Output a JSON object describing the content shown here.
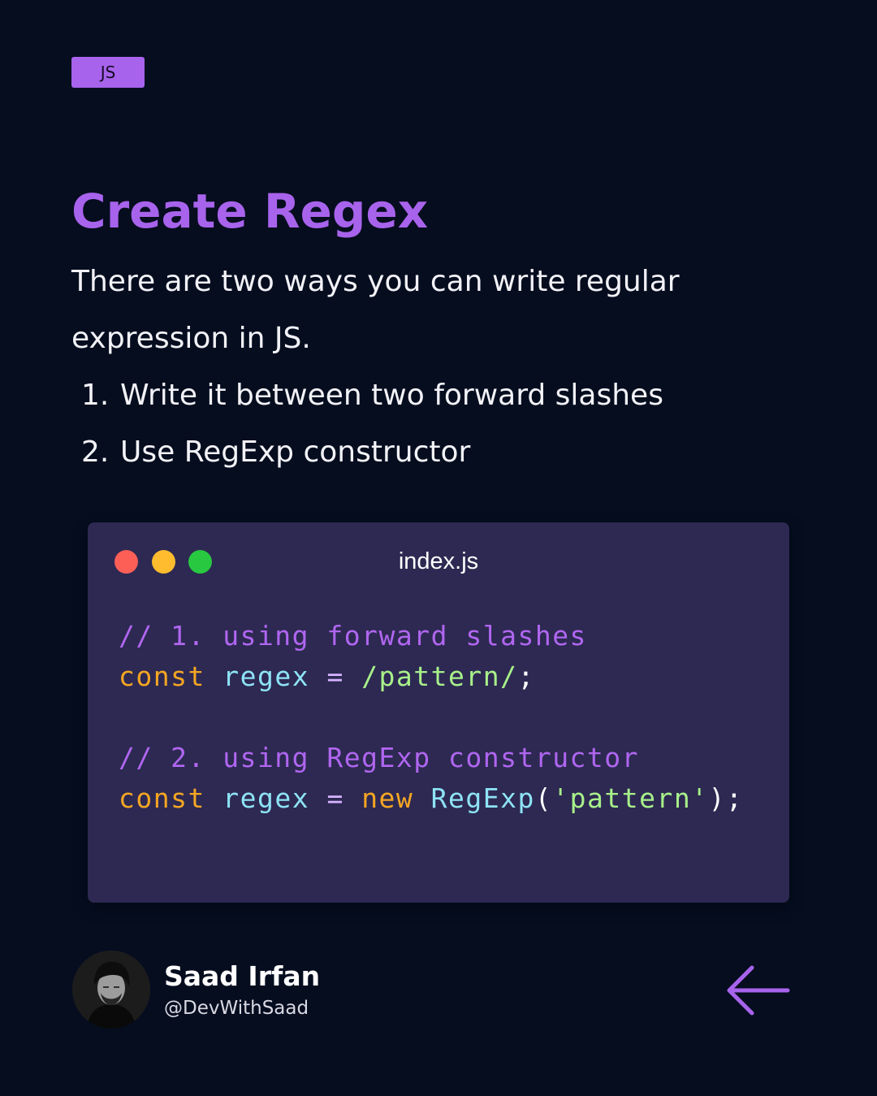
{
  "badge": {
    "label": "JS"
  },
  "title": "Create Regex",
  "intro": "There are two ways you can write regular expression in JS.",
  "steps": [
    {
      "num": "1.",
      "text": "Write it between two forward slashes"
    },
    {
      "num": "2.",
      "text": "Use RegExp constructor"
    }
  ],
  "code_window": {
    "filename": "index.js",
    "lines": [
      [
        {
          "type": "comment",
          "text": "// 1. using forward slashes"
        }
      ],
      [
        {
          "type": "keyword",
          "text": "const "
        },
        {
          "type": "var",
          "text": "regex "
        },
        {
          "type": "op",
          "text": "= "
        },
        {
          "type": "regex",
          "text": "/pattern/"
        },
        {
          "type": "punc",
          "text": ";"
        }
      ],
      [],
      [
        {
          "type": "comment",
          "text": "// 2. using RegExp constructor"
        }
      ],
      [
        {
          "type": "keyword",
          "text": "const "
        },
        {
          "type": "var",
          "text": "regex "
        },
        {
          "type": "op",
          "text": "= "
        },
        {
          "type": "new",
          "text": "new "
        },
        {
          "type": "class",
          "text": "RegExp"
        },
        {
          "type": "punc",
          "text": "("
        },
        {
          "type": "str",
          "text": "'pattern'"
        },
        {
          "type": "punc",
          "text": ");"
        }
      ]
    ]
  },
  "author": {
    "name": "Saad Irfan",
    "handle": "@DevWithSaad"
  },
  "colors": {
    "background": "#050d1f",
    "accent": "#a863ec",
    "code_bg": "#2d2952"
  },
  "icons": {
    "nav": "arrow-left-icon"
  }
}
